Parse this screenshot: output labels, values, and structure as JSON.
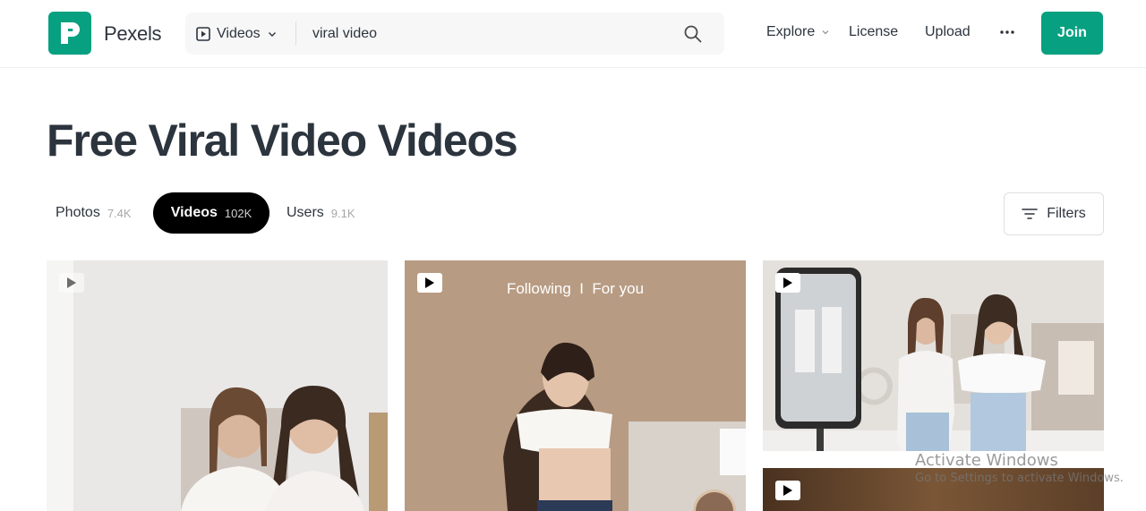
{
  "header": {
    "brand": "Pexels",
    "search": {
      "type_label": "Videos",
      "value": "viral video",
      "placeholder": "viral video"
    },
    "nav": {
      "explore": "Explore",
      "license": "License",
      "upload": "Upload",
      "join": "Join"
    }
  },
  "page": {
    "title": "Free Viral Video Videos"
  },
  "tabs": [
    {
      "label": "Photos",
      "count": "7.4K"
    },
    {
      "label": "Videos",
      "count": "102K"
    },
    {
      "label": "Users",
      "count": "9.1K"
    }
  ],
  "filters_label": "Filters",
  "results": [
    {
      "overlay": ""
    },
    {
      "overlay": "Following  I  For you"
    },
    {
      "overlay": ""
    },
    {
      "overlay": ""
    }
  ],
  "watermark": {
    "title": "Activate Windows",
    "subtitle": "Go to Settings to activate Windows."
  },
  "colors": {
    "brand": "#07a081",
    "text": "#2c343e",
    "active_tab": "#000000"
  },
  "icons": [
    "logo-p-icon",
    "video-play-icon",
    "chevron-down-icon",
    "search-icon",
    "more-dots-icon",
    "filter-lines-icon"
  ]
}
